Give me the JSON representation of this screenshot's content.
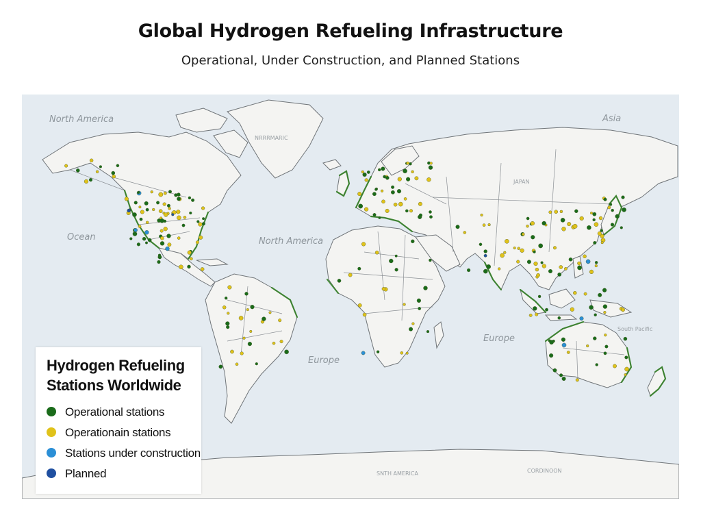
{
  "title": "Global Hydrogen Refueling Infrastructure",
  "subtitle": "Operational, Under Construction, and Planned Stations",
  "map": {
    "labels": {
      "north_america_top": "North America",
      "asia": "Asia",
      "ocean": "Ocean",
      "north_america_mid": "North America",
      "europe_mid": "Europe",
      "europe_low": "Europe",
      "greenland": "NRRRMARIC",
      "japan": "JAPAN",
      "south_america": "SNTH AMERICA",
      "antarctica": "CORDINOON",
      "south_pacific": "South Pacific"
    }
  },
  "legend": {
    "title": "Hydrogen Refueling Stations Worldwide",
    "items": [
      {
        "label": "Operational stations",
        "color": "#1a6b1a"
      },
      {
        "label": "Operationain stations",
        "color": "#e0c21a"
      },
      {
        "label": "Stations under construction",
        "color": "#2b8fd6"
      },
      {
        "label": "Planned",
        "color": "#1f4fa0"
      }
    ]
  },
  "colors": {
    "ocean": "#e4ebf1",
    "land": "#f4f4f2",
    "border": "#8a8f94",
    "coast": "#2e7d1f"
  }
}
